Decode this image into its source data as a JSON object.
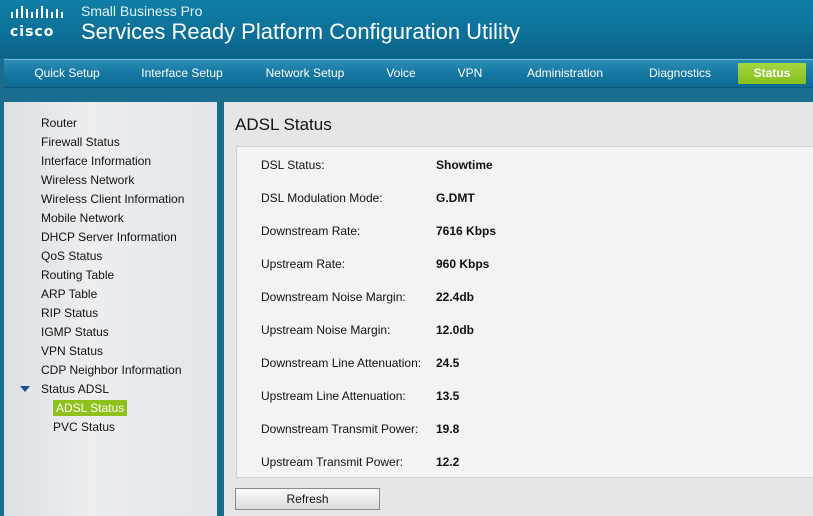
{
  "header": {
    "logo_text": "cisco",
    "subtitle": "Small Business Pro",
    "title": "Services Ready Platform Configuration Utility"
  },
  "nav": {
    "tabs": [
      {
        "label": "Quick Setup"
      },
      {
        "label": "Interface Setup"
      },
      {
        "label": "Network Setup"
      },
      {
        "label": "Voice"
      },
      {
        "label": "VPN"
      },
      {
        "label": "Administration"
      },
      {
        "label": "Diagnostics"
      },
      {
        "label": "Status",
        "active": true
      }
    ]
  },
  "sidebar": {
    "items": [
      {
        "label": "Router"
      },
      {
        "label": "Firewall Status"
      },
      {
        "label": "Interface Information"
      },
      {
        "label": "Wireless Network"
      },
      {
        "label": "Wireless Client Information"
      },
      {
        "label": "Mobile Network"
      },
      {
        "label": "DHCP Server Information"
      },
      {
        "label": "QoS Status"
      },
      {
        "label": "Routing Table"
      },
      {
        "label": "ARP Table"
      },
      {
        "label": "RIP Status"
      },
      {
        "label": "IGMP Status"
      },
      {
        "label": "VPN Status"
      },
      {
        "label": "CDP Neighbor Information"
      },
      {
        "label": "Status ADSL",
        "expanded": true
      },
      {
        "label": "ADSL Status",
        "selected": true
      },
      {
        "label": "PVC Status"
      }
    ]
  },
  "main": {
    "title": "ADSL Status",
    "rows": [
      {
        "label": "DSL Status:",
        "value": "Showtime"
      },
      {
        "label": "DSL Modulation Mode:",
        "value": "G.DMT"
      },
      {
        "label": "Downstream Rate:",
        "value": "7616 Kbps"
      },
      {
        "label": "Upstream Rate:",
        "value": "960 Kbps"
      },
      {
        "label": "Downstream Noise Margin:",
        "value": "22.4db"
      },
      {
        "label": "Upstream Noise Margin:",
        "value": "12.0db"
      },
      {
        "label": "Downstream Line Attenuation:",
        "value": "24.5"
      },
      {
        "label": "Upstream Line Attenuation:",
        "value": "13.5"
      },
      {
        "label": "Downstream Transmit Power:",
        "value": "19.8"
      },
      {
        "label": "Upstream Transmit Power:",
        "value": "12.2"
      }
    ],
    "refresh_label": "Refresh"
  },
  "colors": {
    "header": "#0d7098",
    "accent": "#8ec11b",
    "expander": "#1f4f8f"
  }
}
